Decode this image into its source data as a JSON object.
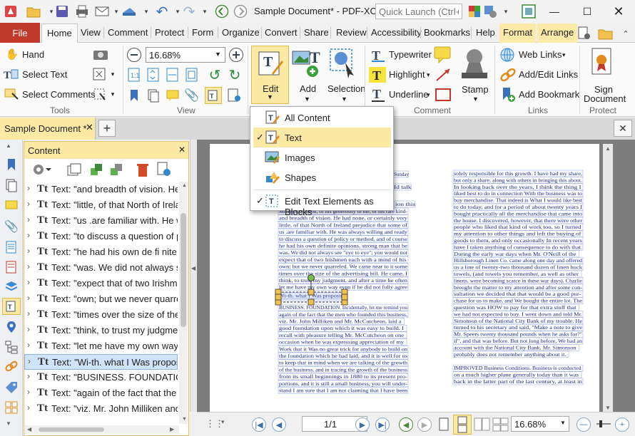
{
  "window": {
    "title": "Sample Document* - PDF-XCh...",
    "quick_launch_placeholder": "Quick Launch (Ctrl+.)"
  },
  "menu_tabs": [
    "File",
    "Home",
    "View",
    "Comment",
    "Protect",
    "Form",
    "Organize",
    "Convert",
    "Share",
    "Review",
    "Accessibility",
    "Bookmarks",
    "Help",
    "Format",
    "Arrange"
  ],
  "ribbon": {
    "tools": {
      "hand": "Hand",
      "select_text": "Select Text",
      "select_comments": "Select Comments",
      "label": "Tools"
    },
    "view": {
      "zoom": "16.68%",
      "label": "View"
    },
    "edit": {
      "label": "Edit",
      "add": "Add",
      "selection": "Selection"
    },
    "comment": {
      "typewriter": "Typewriter",
      "highlight": "Highlight",
      "underline": "Underline",
      "stamp": "Stamp",
      "label": "Comment"
    },
    "links": {
      "web_links": "Web Links",
      "add_edit_links": "Add/Edit Links",
      "add_bookmark": "Add Bookmark",
      "label": "Links"
    },
    "protect": {
      "sign_document_1": "Sign",
      "sign_document_2": "Document",
      "label": "Protect"
    }
  },
  "doc_tab": {
    "label": "Sample Document *"
  },
  "panel": {
    "title": "Content",
    "items": [
      "Text: \"and breadth of vision. He h",
      "Text: \"little, of that North of Irelan",
      "Text: \"us .are familiar with. He wa",
      "Text: \"to discuss a question of pol",
      "Text: \"he had his own de fi nite op",
      "Text: \"was. We did not always see",
      "Text: \"expect that of two Irishmen",
      "Text: \"own; but we never quarrele",
      "Text: \"times over the size of the ac",
      "Text: \"think, to trust my judgment",
      "Text: \"let me have my own way ev",
      "Text: \"Wi-th. what I Was proposin",
      "Text: \"BUSINESS. FOUNDATION. Ir",
      "Text: \"again of the fact that the m",
      "Text: \"viz. Mr. John Milliken and M"
    ],
    "selected_index": 11
  },
  "dropdown": {
    "items": [
      "All Content",
      "Text",
      "Images",
      "Shapes",
      "Edit Text Elements as Blocks"
    ],
    "checked": [
      1,
      4
    ],
    "selected_index": 1
  },
  "status": {
    "page": "1/1",
    "zoom": "16.68%"
  },
  "document": {
    "left_col": [
      "Sunday",
      "Id talk",
      "ion this",
      "Mr. McCutcheon, of his generosity to me, of his rare kind-",
      "and breadth of vision. He had none, or certainly very",
      "little, of that North of Ireland prejudice that some of",
      "us .are familiar with. He was always willing and ready",
      "to discuss a question of policy or method, and of course",
      "he had his own definite opinions, strong man that he",
      "was. We did not always see \"eye to eye\"; you would not",
      "expect that of two Irishmen each with a mind of his",
      "own; but we never quarreled. We came near to it some",
      "times over the size of the advertising bill. He came, I",
      "think, to trust my judgment, and after a time he often",
      "let me have my own way even if he did not fully agree",
      "Wi-th. what I Was proposing",
      "BUSINESS. FOUNDATION. Incidentally, let me remind you",
      "again of the fact that the men who founded this business,",
      "viz. Mr. John Milliken and Mr. McCutcheon, laid a",
      "good foundation upon which it was easy to build. I",
      "recall with pleasure telling Mr. McCutcheon on one",
      "occasion when he was expressing appreciation of my",
      "Work that it Was no great trick for anybody to build on",
      "the foundation which he had laid, and it is well for us",
      "to keep that in mind when we are talking of the growth",
      "of the business, and in tracing the growth of the business",
      "from its small beginnings in 1880 to its present pro-",
      "portions, and it is still a small business, you will under-",
      "stand I am sure that I am not claiming that I have been"
    ],
    "right_col": [
      "solely responsible for this growth. I have had my share,",
      "but only a share, along with others in bringing this about.",
      "In looking back over the years, I think the thing I",
      "liked best to do in connection With the business was to",
      "buy merchandise. That indeed is What I would like best",
      "to do today, and for a period of about twenty years I",
      "bought practically all the merchandise that came into",
      "the house. I discovered, however, that there were other",
      "people who liked that kind of work too, so I turned",
      "my attention to other things and left the buying of",
      "goods to them, and only occasionally In recent years",
      "have I taken anything of consequence to do with that.",
      "During the early war days when Mr. O'Neill of the",
      "Hillsborough Linen Co. came along one day and offered",
      "us a line of twenty-two thousand dozen of linen huck",
      "towels, (and towels you remember, as well as other",
      "linens, were becoming scarce in these war days), Charlie",
      "brought the matter to my attention and after some con-",
      "sultation we decided that that would be a good pur-",
      "chase for us to make, and We bought the entire lot. The",
      "question was HOW to pay for that extra stuff that",
      "we had not expected to buy. I went down and told Mr.",
      "Simonson of the National City Bank of my trouble. He",
      "turned to his secretary and said, \"Make a note to give",
      "Mr. Speers twenty thousand pounds when he asks for?\"",
      "if\", and that was before. But not long before, We had an",
      "account with the National City Bank. Mr. Simonson",
      "probably does not remember anything about it.",
      "IMPROVED Business Conditions. Business is conducted",
      "on a much higher plane generally today than it was",
      "back in the latter part of the last century, at least in"
    ]
  },
  "colors": {
    "file_tab": "#c0392b",
    "accent": "#fce9a3",
    "selection": "#cfe3fb"
  }
}
